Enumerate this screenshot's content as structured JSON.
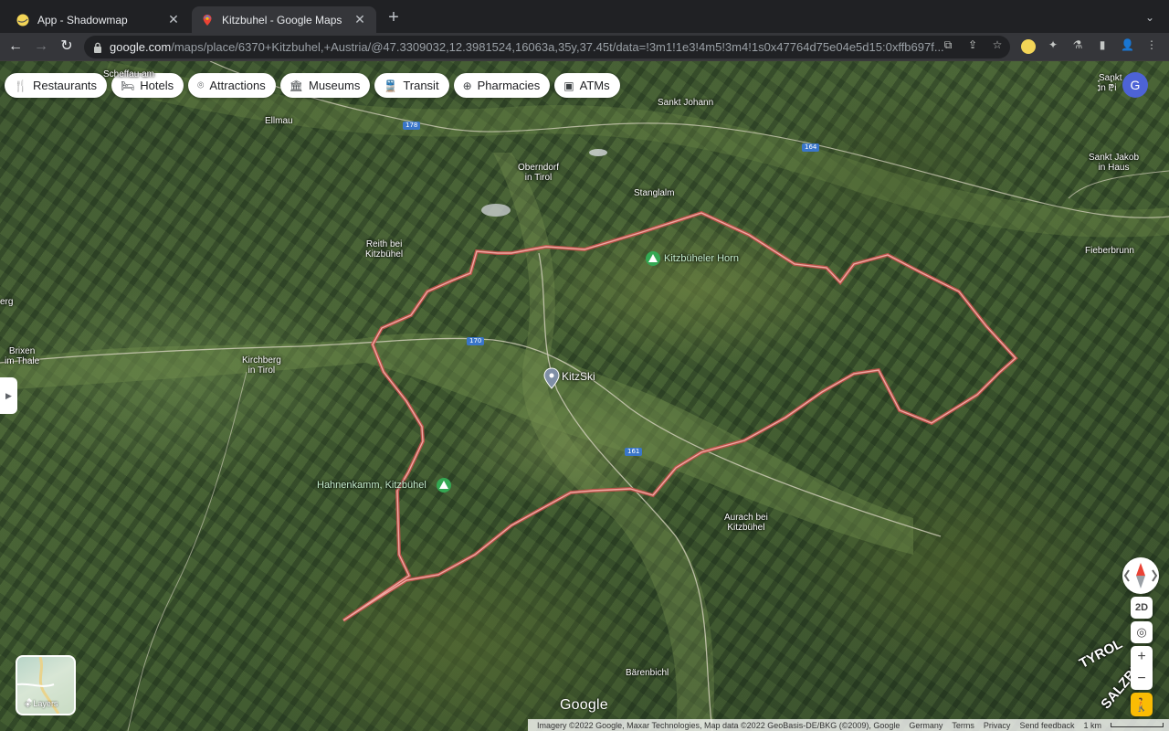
{
  "browser": {
    "tabs": [
      {
        "title": "App - Shadowmap",
        "close": "✕"
      },
      {
        "title": "Kitzbuhel - Google Maps",
        "close": "✕"
      }
    ],
    "new_tab": "+",
    "tab_search": "⌄",
    "nav": {
      "back": "←",
      "forward": "→",
      "reload": "↻"
    },
    "url_host": "google.com",
    "url_path": "/maps/place/6370+Kitzbuhel,+Austria/@47.3309032,12.3981524,16063a,35y,37.45t/data=!3m1!1e3!4m5!3m4!1s0x47764d75e04e5d15:0xffb697f...",
    "icons": {
      "open_in_app": "⧉",
      "share": "⇪",
      "bookmark": "☆",
      "extensions": "✦",
      "profile": "👤",
      "menu": "⋮",
      "sidebar": "▮"
    }
  },
  "map": {
    "chips": [
      {
        "icon": "🍴",
        "label": "Restaurants"
      },
      {
        "icon": "🛏",
        "label": "Hotels"
      },
      {
        "icon": "⌾",
        "label": "Attractions"
      },
      {
        "icon": "🏛",
        "label": "Museums"
      },
      {
        "icon": "🚆",
        "label": "Transit"
      },
      {
        "icon": "⊕",
        "label": "Pharmacies"
      },
      {
        "icon": "▣",
        "label": "ATMs"
      }
    ],
    "places": {
      "scheffau": "Scheffau am",
      "ellmau": "Ellmau",
      "sankt_johann": "Sankt Johann",
      "sankt_jakob": "Sankt Jakob\nin Haus",
      "sankt_pillersee": "Sankt\nin Pi",
      "oberndorf": "Oberndorf\nin Tirol",
      "stanglalm": "Stanglalm",
      "fieberbrunn": "Fieberbrunn",
      "reith": "Reith bei\nKitzbühel",
      "kitzbueheler_horn": "Kitzbüheler Horn",
      "erg": "erg",
      "brixen": "Brixen\nim Thale",
      "kirchberg": "Kirchberg\nin Tirol",
      "kitzski": "KitzSki",
      "hahnenkamm": "Hahnenkamm, Kitzbühel",
      "aurach": "Aurach bei\nKitzbühel",
      "baerenbichl": "Bärenbichl"
    },
    "road_shields": [
      "178",
      "164",
      "170",
      "161"
    ],
    "regions": {
      "tyrol": "TYROL",
      "salzburg": "SALZBU"
    },
    "account_initial": "G",
    "layers_label": "Layers",
    "controls": {
      "mode": "2D",
      "zoom_in": "+",
      "zoom_out": "−",
      "locate": "◎",
      "pegman": "🚶",
      "sidebar_toggle": "▶"
    },
    "logo": "Google",
    "attribution": {
      "imagery": "Imagery ©2022 Google, Maxar Technologies, Map data ©2022 GeoBasis-DE/BKG (©2009), Google",
      "country": "Germany",
      "terms": "Terms",
      "privacy": "Privacy",
      "feedback": "Send feedback",
      "scale": "1 km"
    }
  },
  "colors": {
    "boundary": "#e8837d",
    "account": "#4d63d6",
    "chrome_dark": "#202124",
    "chrome_toolbar": "#35363a"
  }
}
